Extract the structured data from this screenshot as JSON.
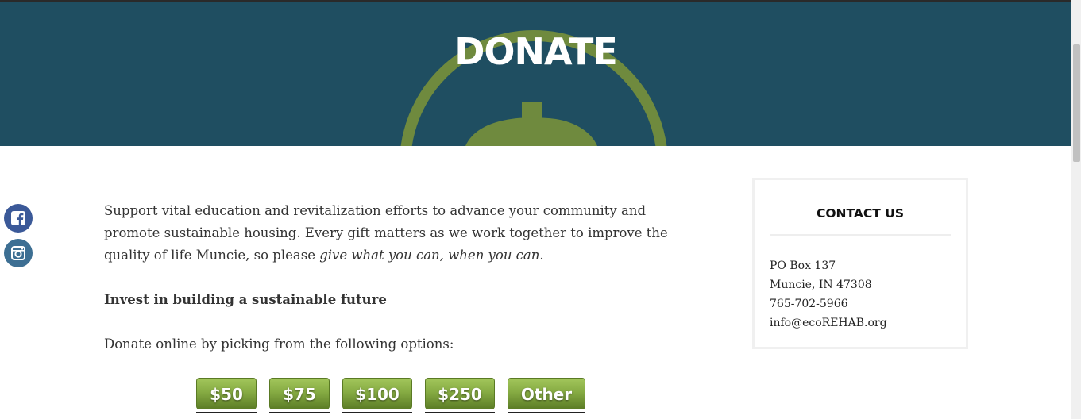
{
  "hero": {
    "title": "DONATE"
  },
  "social": [
    {
      "name": "facebook-icon"
    },
    {
      "name": "instagram-icon"
    }
  ],
  "intro": {
    "text_before": "Support vital education and revitalization efforts to advance your community and promote sustainable housing. Every gift matters as we work together to improve the quality of life Muncie, so please ",
    "emphasis": "give what you can, when you can",
    "text_after": "."
  },
  "subheading": "Invest in building a sustainable future",
  "options_prompt": "Donate online by picking from the following options:",
  "donate_buttons": [
    {
      "label": "$50"
    },
    {
      "label": "$75"
    },
    {
      "label": "$100"
    },
    {
      "label": "$250"
    },
    {
      "label": "Other"
    }
  ],
  "contact": {
    "title": "CONTACT US",
    "address1": "PO Box 137",
    "address2": "Muncie, IN 47308",
    "phone": "765-702-5966",
    "email": "info@ecoREHAB.org"
  },
  "colors": {
    "hero_bg": "#1f4e61",
    "hero_logo": "#6f8a3e",
    "button_green": "#86ab43"
  }
}
